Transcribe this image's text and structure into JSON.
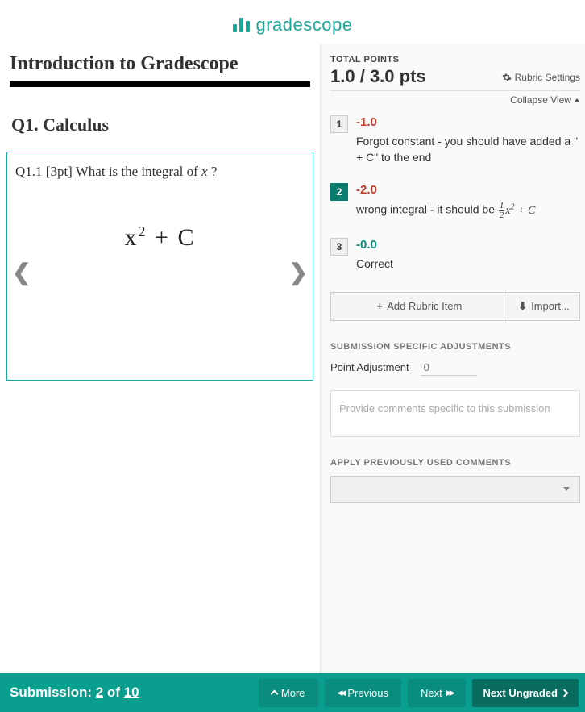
{
  "logo": {
    "text": "gradescope"
  },
  "document": {
    "title": "Introduction to Gradescope",
    "question_number": "Q1.  Calculus",
    "subquestion": "Q1.1  [3pt] What is the integral of ",
    "variable": "x",
    "qmark": " ?",
    "answer_base": "x",
    "answer_exp": "2",
    "answer_rest": " + C"
  },
  "grading": {
    "total_label": "TOTAL POINTS",
    "earned": "1.0",
    "sep": " / ",
    "possible": "3.0",
    "unit": " pts",
    "settings_label": "Rubric Settings",
    "collapse_label": "Collapse View",
    "rubric": [
      {
        "num": "1",
        "points": "-1.0",
        "desc": "Forgot constant - you should have added a \" + C\" to the end",
        "active": false,
        "color": "red"
      },
      {
        "num": "2",
        "points": "-2.0",
        "desc_prefix": "wrong integral - it should be ",
        "active": true,
        "color": "red",
        "has_math": true
      },
      {
        "num": "3",
        "points": "-0.0",
        "desc": "Correct",
        "active": false,
        "color": "teal"
      }
    ],
    "add_item": "Add Rubric Item",
    "import": "Import...",
    "adjustments_label": "SUBMISSION SPECIFIC ADJUSTMENTS",
    "point_adj_label": "Point Adjustment",
    "point_adj_placeholder": "0",
    "comment_placeholder": "Provide comments specific to this submission",
    "apply_comments_label": "APPLY PREVIOUSLY USED COMMENTS"
  },
  "footer": {
    "submission_prefix": "Submission: ",
    "current": "2",
    "of": " of ",
    "total": "10",
    "more": "More",
    "previous": "Previous",
    "next": "Next",
    "next_ungraded": "Next Ungraded"
  }
}
